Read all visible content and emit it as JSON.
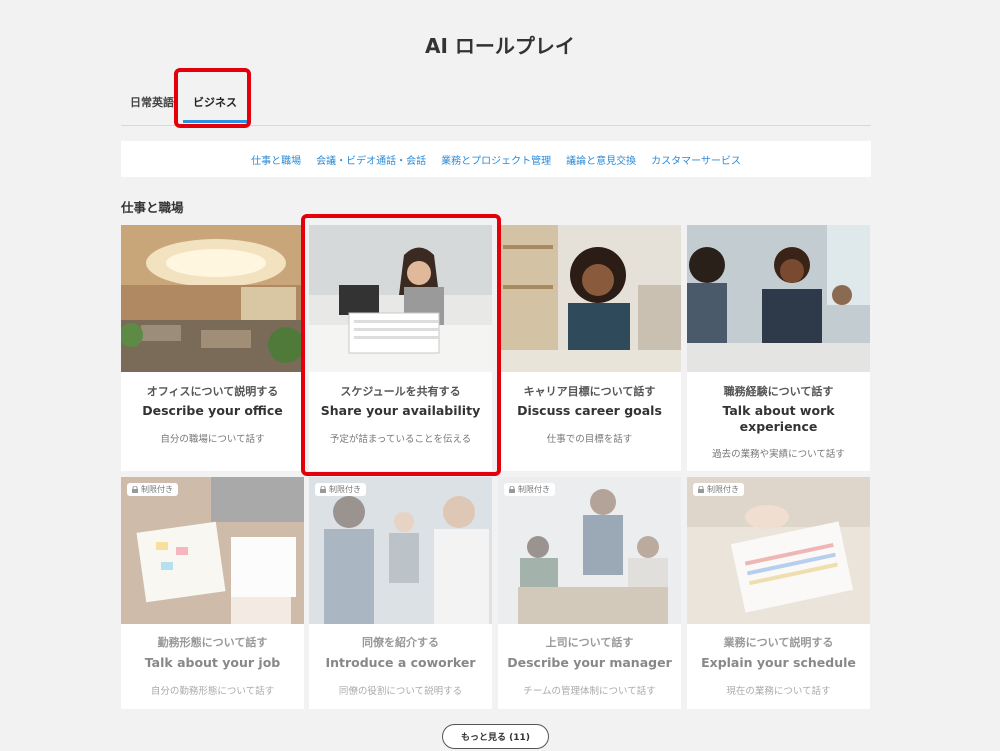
{
  "page": {
    "title": "AI ロールプレイ"
  },
  "tabs": [
    {
      "label": "日常英語"
    },
    {
      "label": "ビジネス"
    }
  ],
  "categories": [
    {
      "label": "仕事と職場"
    },
    {
      "label": "会議・ビデオ通話・会話"
    },
    {
      "label": "業務とプロジェクト管理"
    },
    {
      "label": "議論と意見交換"
    },
    {
      "label": "カスタマーサービス"
    }
  ],
  "section": {
    "title": "仕事と職場"
  },
  "cards": [
    {
      "jp": "オフィスについて説明する",
      "en": "Describe your office",
      "desc": "自分の職場について話す"
    },
    {
      "jp": "スケジュールを共有する",
      "en": "Share your availability",
      "desc": "予定が詰まっていることを伝える"
    },
    {
      "jp": "キャリア目標について話す",
      "en": "Discuss career goals",
      "desc": "仕事での目標を話す"
    },
    {
      "jp": "職務経験について話す",
      "en": "Talk about work experience",
      "desc": "過去の業務や実績について話す"
    },
    {
      "jp": "勤務形態について話す",
      "en": "Talk about your job",
      "desc": "自分の勤務形態について話す",
      "badge": "制限付き"
    },
    {
      "jp": "同僚を紹介する",
      "en": "Introduce a coworker",
      "desc": "同僚の役割について説明する",
      "badge": "制限付き"
    },
    {
      "jp": "上司について話す",
      "en": "Describe your manager",
      "desc": "チームの管理体制について話す",
      "badge": "制限付き"
    },
    {
      "jp": "業務について説明する",
      "en": "Explain your schedule",
      "desc": "現在の業務について話す",
      "badge": "制限付き"
    }
  ],
  "more_button": {
    "label": "もっと見る (11)"
  },
  "colors": {
    "accent": "#2f8fe0",
    "highlight": "#e3000b",
    "link": "#2a8bd9"
  }
}
